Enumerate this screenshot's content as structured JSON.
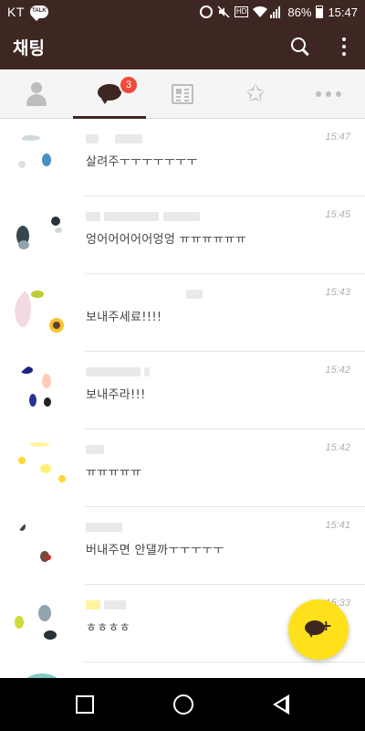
{
  "status_bar": {
    "carrier": "KT",
    "talk_label": "TALK",
    "hd_label": "HD",
    "battery_percent": "86%",
    "battery_level": 0.86,
    "time": "15:47"
  },
  "header": {
    "title": "채팅",
    "search_icon": "search-icon",
    "more_icon": "more-vert-icon"
  },
  "tabs": [
    {
      "name": "friends",
      "icon": "person-icon"
    },
    {
      "name": "chats",
      "icon": "chat-bubble-icon",
      "badge": "3",
      "active": true
    },
    {
      "name": "news",
      "icon": "newspaper-icon"
    },
    {
      "name": "favorites",
      "icon": "star-icon"
    },
    {
      "name": "more",
      "icon": "more-horiz-icon"
    }
  ],
  "chats": [
    {
      "message": "살려주ㅜㅜㅜㅜㅜㅜㅜ",
      "time": "15:47"
    },
    {
      "message": "엉어어어어어엉엉 ㅠㅠㅠㅠㅠㅠ",
      "time": "15:45"
    },
    {
      "message": "보내주세료!!!!",
      "time": "15:43"
    },
    {
      "message": "보내주라!!!",
      "time": "15:42"
    },
    {
      "message": "ㅠㅠㅠㅠㅠ",
      "time": "15:42"
    },
    {
      "message": "버내주면 안댈까ㅜㅜㅜㅜㅜ",
      "time": "15:41"
    },
    {
      "message": "ㅎㅎㅎㅎ",
      "time": "15:33"
    },
    {
      "message": "",
      "time": ""
    }
  ],
  "colors": {
    "brand_brown": "#3e2723",
    "badge_red": "#ef4a3a",
    "fab_yellow": "#ffe11b"
  }
}
